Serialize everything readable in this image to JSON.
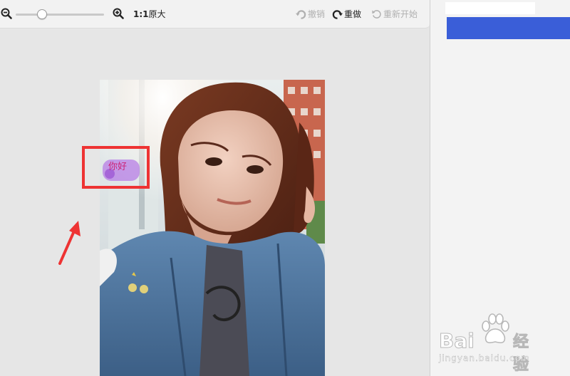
{
  "toolbar": {
    "zoom_level": 0.3,
    "zoom_reset": {
      "ratio": "1:1",
      "label": "原大"
    },
    "undo_label": "撤销",
    "redo_label": "重做",
    "restart_label": "重新开始"
  },
  "canvas": {
    "sticker_text": "你好"
  },
  "watermark": {
    "brand": "Bai",
    "product": "经验",
    "url": "jingyan.baidu.com"
  },
  "colors": {
    "accent_blue": "#3a5ed8",
    "annotation_red": "#ee3333",
    "sticker_purple": "#b77ee6"
  },
  "icons": {
    "zoom_out": "zoom-out-icon",
    "zoom_in": "zoom-in-icon",
    "undo": "undo-icon",
    "redo": "redo-icon",
    "restart": "restart-icon"
  }
}
